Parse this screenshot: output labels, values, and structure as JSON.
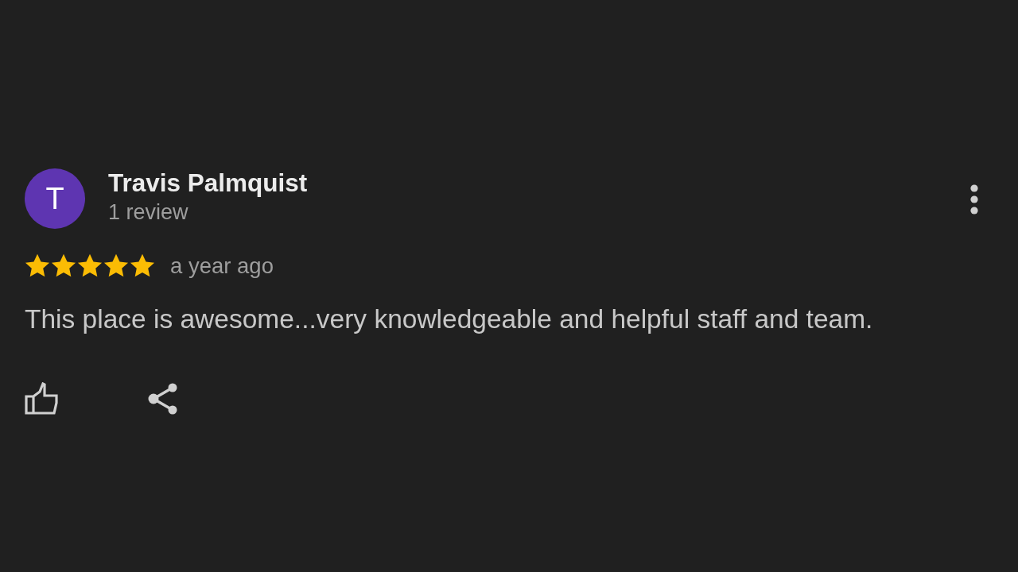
{
  "review": {
    "avatar": {
      "initial": "T"
    },
    "author": {
      "name": "Travis Palmquist",
      "reviews": "1 review"
    },
    "stars": 5,
    "time": "a year ago",
    "text": "This place is awesome...very knowledgeable and helpful staff and team.",
    "actions": [
      {
        "kind": "like"
      },
      {
        "kind": "share"
      }
    ]
  }
}
